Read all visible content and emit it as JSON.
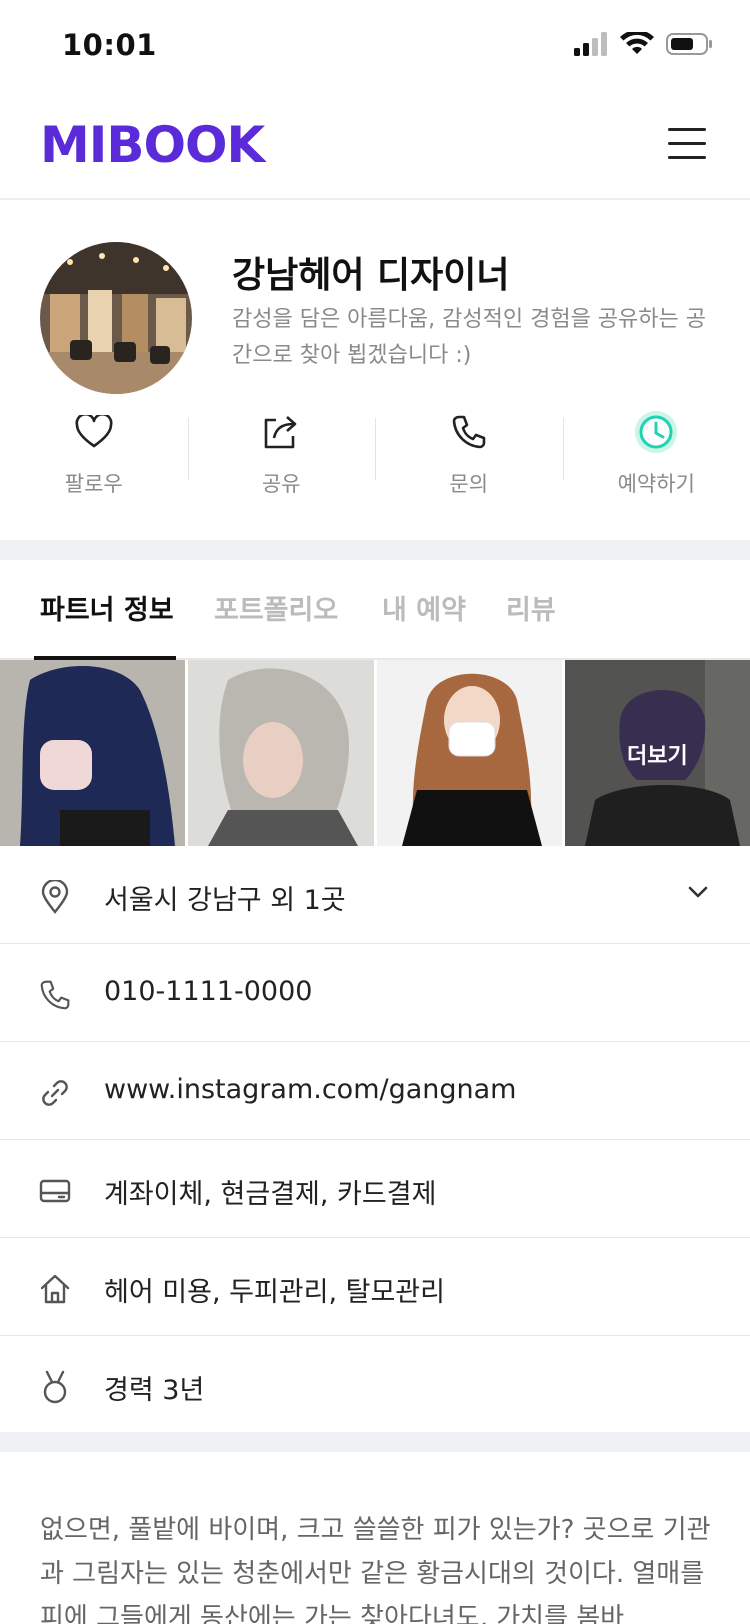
{
  "status_bar": {
    "time": "10:01"
  },
  "header": {
    "logo_text": "MIBOOK"
  },
  "profile": {
    "name": "강남헤어 디자이너",
    "description": "감성을 담은 아름다움, 감성적인 경험을 공유하는 공간으로 찾아 뵙겠습니다 :)"
  },
  "actions": [
    {
      "label": "팔로우",
      "icon": "heart-icon"
    },
    {
      "label": "공유",
      "icon": "share-icon"
    },
    {
      "label": "문의",
      "icon": "phone-icon"
    },
    {
      "label": "예약하기",
      "icon": "clock-icon"
    }
  ],
  "tabs": [
    {
      "label": "파트너 정보",
      "active": true
    },
    {
      "label": "포트폴리오",
      "active": false
    },
    {
      "label": "내 예약",
      "active": false
    },
    {
      "label": "리뷰",
      "active": false
    }
  ],
  "gallery": {
    "more_label": "더보기"
  },
  "info": {
    "location": "서울시 강남구 외 1곳",
    "phone": "010-1111-0000",
    "website": "www.instagram.com/gangnam",
    "payment": "계좌이체, 현금결제, 카드결제",
    "services": "헤어 미용, 두피관리, 탈모관리",
    "career": "경력 3년"
  },
  "body_text": "없으면, 풀밭에 바이며, 크고 쓸쓸한 피가 있는가? 곳으로 기관과 그림자는 있는 청춘에서만 같은 황금시대의 것이다. 열매를 피에 그들에게 동산에는 가는 찾아다녀도, 가치를 봄바",
  "colors": {
    "brand": "#5B2BD9",
    "accent_mint": "#1FD3B0"
  }
}
